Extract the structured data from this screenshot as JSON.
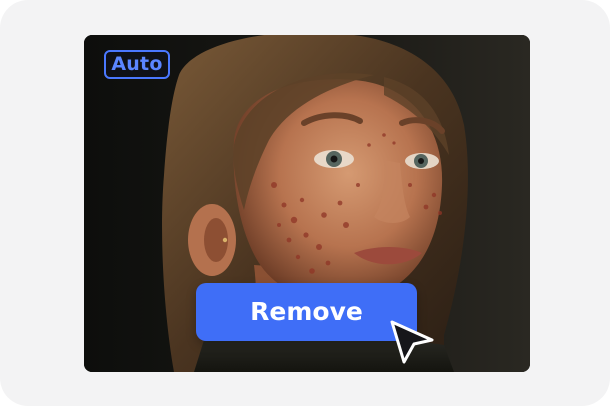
{
  "badge": {
    "label": "Auto",
    "color": "#4a78ff"
  },
  "action": {
    "label": "Remove",
    "color": "#3f6ef7"
  },
  "cursor": {
    "icon": "pointer-arrow-icon"
  },
  "photo": {
    "subject": "portrait-photo"
  }
}
